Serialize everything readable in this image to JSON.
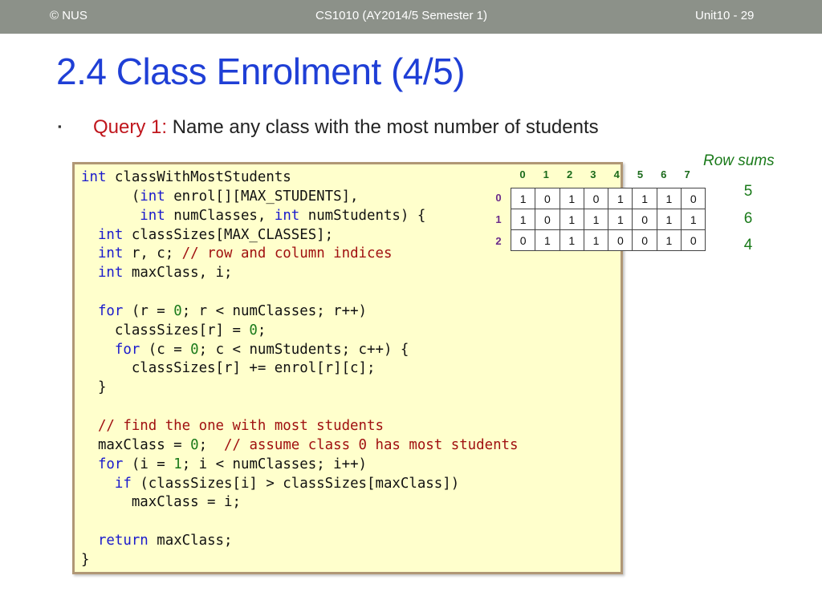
{
  "header": {
    "left": "© NUS",
    "center": "CS1010 (AY2014/5 Semester 1)",
    "right": "Unit10 - 29"
  },
  "title": "2.4 Class Enrolment (4/5)",
  "bullet": {
    "symbol": "▪",
    "label": "Query 1:",
    "text": " Name any class with the most number of students"
  },
  "code": [
    [
      [
        "kw",
        "int"
      ],
      [
        "t",
        " classWithMostStudents"
      ]
    ],
    [
      [
        "t",
        "      ("
      ],
      [
        "kw",
        "int"
      ],
      [
        "t",
        " enrol[][MAX_STUDENTS],"
      ]
    ],
    [
      [
        "t",
        "       "
      ],
      [
        "kw",
        "int"
      ],
      [
        "t",
        " numClasses, "
      ],
      [
        "kw",
        "int"
      ],
      [
        "t",
        " numStudents) {"
      ]
    ],
    [
      [
        "t",
        "  "
      ],
      [
        "kw",
        "int"
      ],
      [
        "t",
        " classSizes[MAX_CLASSES];"
      ]
    ],
    [
      [
        "t",
        "  "
      ],
      [
        "kw",
        "int"
      ],
      [
        "t",
        " r, c; "
      ],
      [
        "cm",
        "// row and column indices"
      ]
    ],
    [
      [
        "t",
        "  "
      ],
      [
        "kw",
        "int"
      ],
      [
        "t",
        " maxClass, i;"
      ]
    ],
    [
      [
        "t",
        ""
      ]
    ],
    [
      [
        "t",
        "  "
      ],
      [
        "kw",
        "for"
      ],
      [
        "t",
        " (r = "
      ],
      [
        "num",
        "0"
      ],
      [
        "t",
        "; r < numClasses; r++)"
      ]
    ],
    [
      [
        "t",
        "    classSizes[r] = "
      ],
      [
        "num",
        "0"
      ],
      [
        "t",
        ";"
      ]
    ],
    [
      [
        "t",
        "    "
      ],
      [
        "kw",
        "for"
      ],
      [
        "t",
        " (c = "
      ],
      [
        "num",
        "0"
      ],
      [
        "t",
        "; c < numStudents; c++) {"
      ]
    ],
    [
      [
        "t",
        "      classSizes[r] += enrol[r][c];"
      ]
    ],
    [
      [
        "t",
        "  }"
      ]
    ],
    [
      [
        "t",
        ""
      ]
    ],
    [
      [
        "t",
        "  "
      ],
      [
        "cm",
        "// find the one with most students"
      ]
    ],
    [
      [
        "t",
        "  maxClass = "
      ],
      [
        "num",
        "0"
      ],
      [
        "t",
        ";  "
      ],
      [
        "cm",
        "// assume class 0 has most students"
      ]
    ],
    [
      [
        "t",
        "  "
      ],
      [
        "kw",
        "for"
      ],
      [
        "t",
        " (i = "
      ],
      [
        "num",
        "1"
      ],
      [
        "t",
        "; i < numClasses; i++)"
      ]
    ],
    [
      [
        "t",
        "    "
      ],
      [
        "kw",
        "if"
      ],
      [
        "t",
        " (classSizes[i] > classSizes[maxClass])"
      ]
    ],
    [
      [
        "t",
        "      maxClass = i;"
      ]
    ],
    [
      [
        "t",
        ""
      ]
    ],
    [
      [
        "t",
        "  "
      ],
      [
        "kw",
        "return"
      ],
      [
        "t",
        " maxClass;"
      ]
    ],
    [
      [
        "t",
        "}"
      ]
    ]
  ],
  "matrix": {
    "col_headers": [
      "0",
      "1",
      "2",
      "3",
      "4",
      "5",
      "6",
      "7"
    ],
    "row_headers": [
      "0",
      "1",
      "2"
    ],
    "rows": [
      [
        "1",
        "0",
        "1",
        "0",
        "1",
        "1",
        "1",
        "0"
      ],
      [
        "1",
        "0",
        "1",
        "1",
        "1",
        "0",
        "1",
        "1"
      ],
      [
        "0",
        "1",
        "1",
        "1",
        "0",
        "0",
        "1",
        "0"
      ]
    ],
    "row_sums_title": "Row sums",
    "row_sums": [
      "5",
      "6",
      "4"
    ]
  }
}
